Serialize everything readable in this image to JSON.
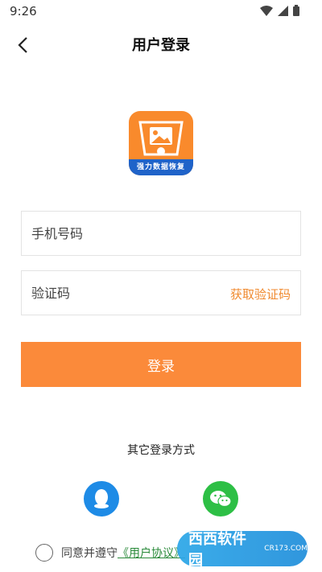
{
  "status_bar": {
    "time": "9:26"
  },
  "nav": {
    "title": "用户登录"
  },
  "logo": {
    "caption": "强力数据恢复"
  },
  "form": {
    "phone_placeholder": "手机号码",
    "code_placeholder": "验证码",
    "get_code_label": "获取验证码",
    "login_label": "登录"
  },
  "other_login": {
    "title": "其它登录方式",
    "options": [
      "qq-icon",
      "wechat-icon"
    ]
  },
  "agreement": {
    "prefix": "同意并遵守",
    "link": "《用户协议》"
  },
  "watermark": {
    "name": "西西软件园",
    "domain": "CR173.COM"
  },
  "colors": {
    "accent": "#fb8a3a",
    "qq": "#1e8be6",
    "wechat": "#2dbf45",
    "ribbon": "#1f63c9"
  }
}
